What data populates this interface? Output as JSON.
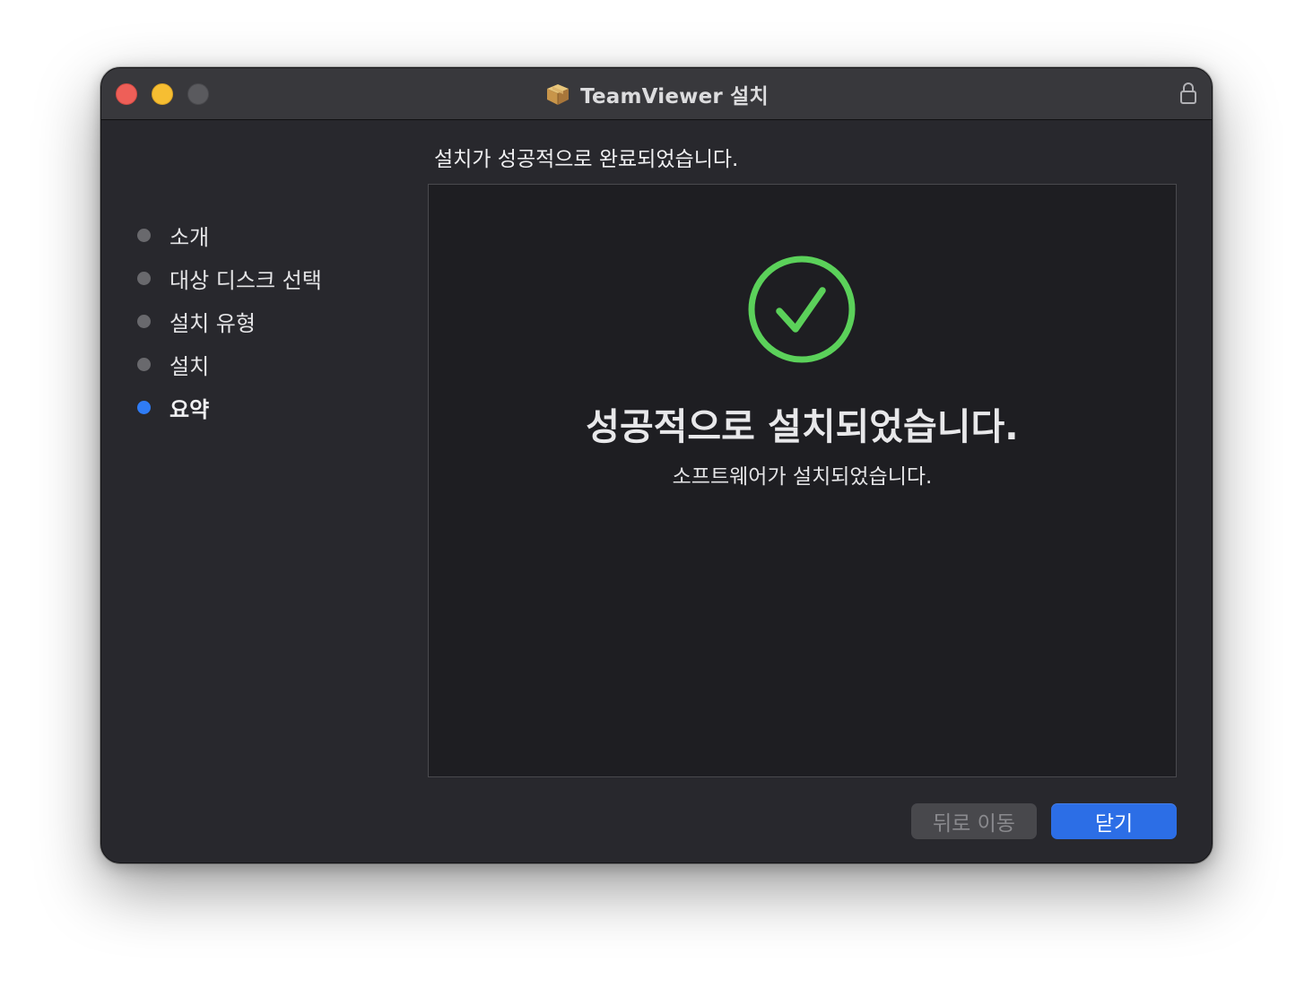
{
  "window": {
    "title": "TeamViewer 설치",
    "accent_color": "#2c6ee6",
    "success_color": "#5bd15a"
  },
  "sidebar": {
    "steps": [
      {
        "label": "소개",
        "state": "done"
      },
      {
        "label": "대상 디스크 선택",
        "state": "done"
      },
      {
        "label": "설치 유형",
        "state": "done"
      },
      {
        "label": "설치",
        "state": "done"
      },
      {
        "label": "요약",
        "state": "active"
      }
    ]
  },
  "main": {
    "heading": "설치가 성공적으로 완료되었습니다.",
    "success_icon": "checkmark-circle-icon",
    "success_title": "성공적으로 설치되었습니다.",
    "success_subtitle": "소프트웨어가 설치되었습니다."
  },
  "footer": {
    "back_label": "뒤로 이동",
    "back_enabled": false,
    "close_label": "닫기"
  }
}
